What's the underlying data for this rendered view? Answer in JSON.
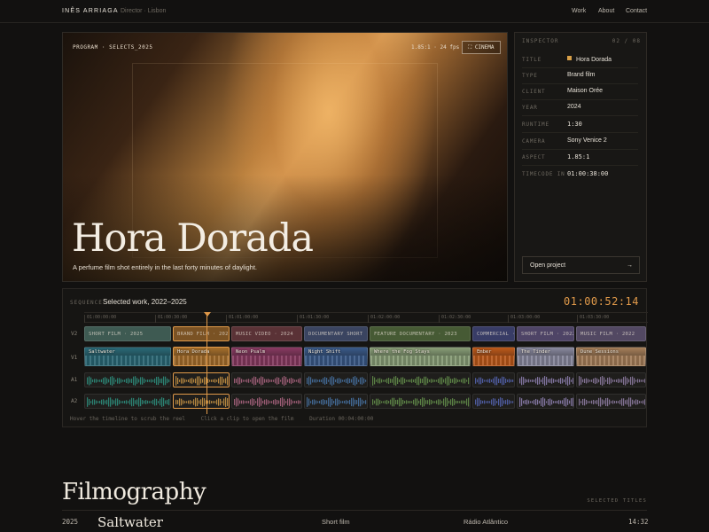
{
  "nav": {
    "brand": "INÊS ARRIAGA",
    "role": "Director · Lisbon",
    "links": [
      "Work",
      "About",
      "Contact"
    ]
  },
  "monitor": {
    "label": "PROGRAM · SELECTS_2025",
    "fps": "1.85:1 · 24 fps",
    "cinema_button": "CINEMA",
    "title": "Hora Dorada",
    "subtitle": "A perfume film shot entirely in the last forty minutes of daylight."
  },
  "inspector": {
    "heading": "INSPECTOR",
    "count": "02 / 08",
    "rows": [
      {
        "key": "TITLE",
        "value": "Hora Dorada"
      },
      {
        "key": "TYPE",
        "value": "Brand film"
      },
      {
        "key": "CLIENT",
        "value": "Maison Orée"
      },
      {
        "key": "YEAR",
        "value": "2024"
      },
      {
        "key": "RUNTIME",
        "value": "1:30"
      },
      {
        "key": "CAMERA",
        "value": "Sony Venice 2"
      },
      {
        "key": "ASPECT",
        "value": "1.85:1"
      },
      {
        "key": "TIMECODE IN",
        "value": "01:00:38:00"
      }
    ],
    "open_button": "Open project",
    "open_arrow": "→",
    "accent": "#d9a048"
  },
  "sequence": {
    "label": "SEQUENCE",
    "title": "Selected work, 2022–2025",
    "timecode": "01:00:52:14",
    "ruler": [
      "01:00:00:00",
      "01:00:30:00",
      "01:01:00:00",
      "01:01:30:00",
      "01:02:00:00",
      "01:02:30:00",
      "01:03:00:00",
      "01:03:30:00"
    ],
    "track_labels": [
      "V2",
      "V1",
      "A1",
      "A2"
    ],
    "v2": [
      {
        "text": "SHORT FILM · 2025",
        "color": "#3e5a52"
      },
      {
        "text": "BRAND FILM · 2024",
        "color": "#7a5224"
      },
      {
        "text": "MUSIC VIDEO · 2024",
        "color": "#5a3236"
      },
      {
        "text": "DOCUMENTARY SHORT · 2023",
        "color": "#3a4460"
      },
      {
        "text": "FEATURE DOCUMENTARY · 2023",
        "color": "#465a34"
      },
      {
        "text": "COMMERCIAL · 2022",
        "color": "#383c66"
      },
      {
        "text": "SHORT FILM · 2022",
        "color": "#4e4466"
      },
      {
        "text": "MUSIC FILM · 2022",
        "color": "#524862"
      }
    ],
    "v1": [
      {
        "text": "Saltwater",
        "color": "#2a6a78"
      },
      {
        "text": "Hora Dorada",
        "color": "#a8702c"
      },
      {
        "text": "Neon Psalm",
        "color": "#8a3a62"
      },
      {
        "text": "Night Shift",
        "color": "#3a5a8a"
      },
      {
        "text": "Where the Fog Stays",
        "color": "#8aa078"
      },
      {
        "text": "Ember",
        "color": "#c05a1a"
      },
      {
        "text": "The Tinder",
        "color": "#8a8aa0"
      },
      {
        "text": "Dune Sessions",
        "color": "#a8805a"
      }
    ],
    "audio_colors": [
      "#2e9a88",
      "#d9a048",
      "#b86a8a",
      "#4a7ab0",
      "#6a9a50",
      "#5a6ac0",
      "#9a8ac0",
      "#9a86b0"
    ],
    "footer": [
      "Hover the timeline to scrub the reel",
      "Click a clip to open the film",
      "Duration 00:04:00:00"
    ]
  },
  "filmography": {
    "title": "Filmography",
    "selected": "SELECTED TITLES",
    "row": {
      "year": "2025",
      "title": "Saltwater",
      "type": "Short film",
      "client": "Rádio Atlântico",
      "runtime": "14:32"
    }
  }
}
